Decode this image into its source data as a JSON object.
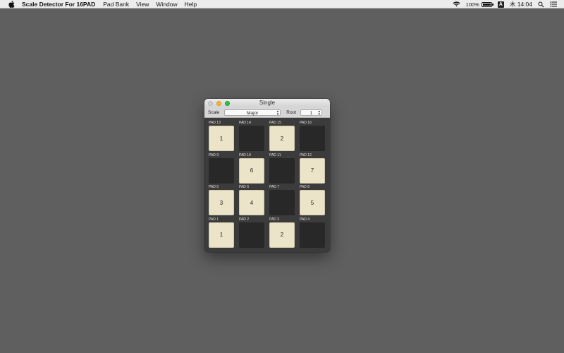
{
  "menubar": {
    "apple_icon": "apple-icon",
    "app_name": "Scale Detector For 16PAD",
    "items": [
      "Pad Bank",
      "View",
      "Window",
      "Help"
    ],
    "status": {
      "wifi_icon": "wifi-icon",
      "battery_percent": "100%",
      "battery_level": 1.0,
      "input_icon_text": "A",
      "clock": "木 14:04",
      "search_icon": "search-icon",
      "list_icon": "list-icon"
    }
  },
  "window": {
    "title": "Single",
    "toolbar": {
      "scale_label": "Scale",
      "scale_value": "Major",
      "root_label": "Root",
      "root_value": "1"
    },
    "rows": [
      [
        {
          "label": "PAD 13",
          "value": "1",
          "active": true
        },
        {
          "label": "PAD 14",
          "value": "",
          "active": false
        },
        {
          "label": "PAD 15",
          "value": "2",
          "active": true
        },
        {
          "label": "PAD 16",
          "value": "",
          "active": false
        }
      ],
      [
        {
          "label": "PAD 9",
          "value": "",
          "active": false
        },
        {
          "label": "PAD 10",
          "value": "6",
          "active": true
        },
        {
          "label": "PAD 11",
          "value": "",
          "active": false
        },
        {
          "label": "PAD 12",
          "value": "7",
          "active": true
        }
      ],
      [
        {
          "label": "PAD 5",
          "value": "3",
          "active": true
        },
        {
          "label": "PAD 6",
          "value": "4",
          "active": true
        },
        {
          "label": "PAD 7",
          "value": "",
          "active": false
        },
        {
          "label": "PAD 8",
          "value": "5",
          "active": true
        }
      ],
      [
        {
          "label": "PAD 1",
          "value": "1",
          "active": true
        },
        {
          "label": "PAD 2",
          "value": "",
          "active": false
        },
        {
          "label": "PAD 3",
          "value": "2",
          "active": true
        },
        {
          "label": "PAD 4",
          "value": "",
          "active": false
        }
      ]
    ],
    "colors": {
      "pad_on": "#ece4c9",
      "pad_off": "#282828",
      "window_bg": "#3b3b3b",
      "desktop_bg": "#5f5f5f"
    }
  }
}
